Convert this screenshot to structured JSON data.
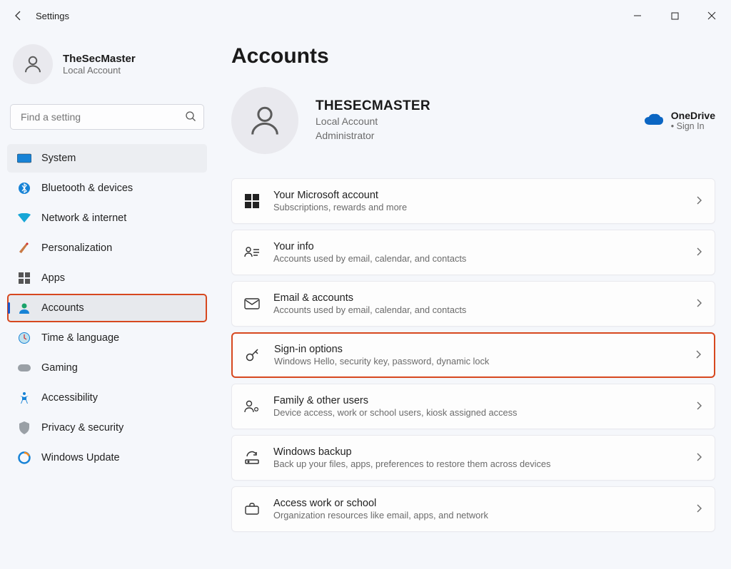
{
  "window": {
    "title": "Settings"
  },
  "sidebar": {
    "profile": {
      "name": "TheSecMaster",
      "sub": "Local Account"
    },
    "search_placeholder": "Find a setting",
    "items": [
      {
        "label": "System"
      },
      {
        "label": "Bluetooth & devices"
      },
      {
        "label": "Network & internet"
      },
      {
        "label": "Personalization"
      },
      {
        "label": "Apps"
      },
      {
        "label": "Accounts"
      },
      {
        "label": "Time & language"
      },
      {
        "label": "Gaming"
      },
      {
        "label": "Accessibility"
      },
      {
        "label": "Privacy & security"
      },
      {
        "label": "Windows Update"
      }
    ]
  },
  "main": {
    "title": "Accounts",
    "account": {
      "name": "THESECMASTER",
      "type": "Local Account",
      "role": "Administrator"
    },
    "onedrive": {
      "label": "OneDrive",
      "status": "Sign In"
    },
    "cards": [
      {
        "title": "Your Microsoft account",
        "sub": "Subscriptions, rewards and more"
      },
      {
        "title": "Your info",
        "sub": "Accounts used by email, calendar, and contacts"
      },
      {
        "title": "Email & accounts",
        "sub": "Accounts used by email, calendar, and contacts"
      },
      {
        "title": "Sign-in options",
        "sub": "Windows Hello, security key, password, dynamic lock"
      },
      {
        "title": "Family & other users",
        "sub": "Device access, work or school users, kiosk assigned access"
      },
      {
        "title": "Windows backup",
        "sub": "Back up your files, apps, preferences to restore them across devices"
      },
      {
        "title": "Access work or school",
        "sub": "Organization resources like email, apps, and network"
      }
    ]
  }
}
